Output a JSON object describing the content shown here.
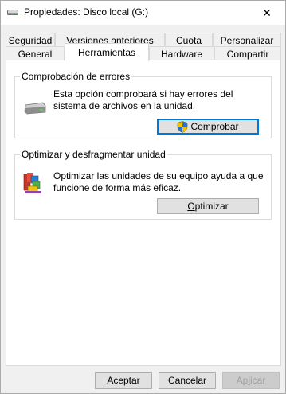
{
  "window": {
    "title": "Propiedades: Disco local (G:)",
    "close_label": "✕"
  },
  "tabs_row1": [
    {
      "label": "Seguridad"
    },
    {
      "label": "Versiones anteriores"
    },
    {
      "label": "Cuota"
    },
    {
      "label": "Personalizar"
    }
  ],
  "tabs_row2": [
    {
      "label": "General"
    },
    {
      "label": "Herramientas",
      "active": true
    },
    {
      "label": "Hardware"
    },
    {
      "label": "Compartir"
    }
  ],
  "error_check": {
    "title": "Comprobación de errores",
    "description_line1": "Esta opción comprobará si hay errores del",
    "description_line2": "sistema de archivos en la unidad.",
    "button_first": "C",
    "button_rest": "omprobar",
    "icon": "drive-icon"
  },
  "optimize": {
    "title": "Optimizar y desfragmentar unidad",
    "description_line1": "Optimizar las unidades de su equipo ayuda a que",
    "description_line2": "funcione de forma más eficaz.",
    "button_first": "O",
    "button_rest": "ptimizar",
    "icon": "defrag-icon"
  },
  "footer": {
    "accept": "Aceptar",
    "cancel": "Cancelar",
    "apply_before": "Ap",
    "apply_ul": "l",
    "apply_after": "icar"
  }
}
